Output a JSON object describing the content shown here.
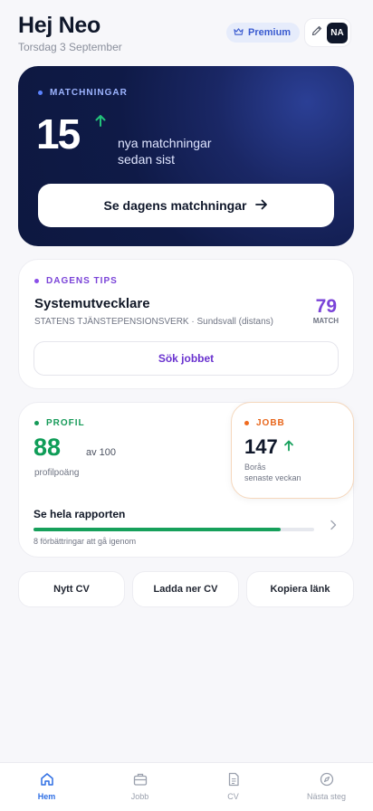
{
  "header": {
    "greeting": "Hej Neo",
    "date": "Torsdag 3 September",
    "premium_label": "Premium",
    "avatar_initials": "NA"
  },
  "hero": {
    "eyebrow": "MATCHNINGAR",
    "count": "15",
    "subtitle": "nya matchningar sedan sist",
    "cta_label": "Se dagens matchningar"
  },
  "tips": {
    "eyebrow": "DAGENS TIPS",
    "job_title": "Systemutvecklare",
    "job_meta": "STATENS TJÄNSTEPENSIONSVERK · Sundsvall (distans)",
    "match_score": "79",
    "match_label": "MATCH",
    "cta_label": "Sök jobbet"
  },
  "profil": {
    "eyebrow": "PROFIL",
    "score": "88",
    "score_suffix": "av 100",
    "score_label": "profilpoäng",
    "report_title": "Se hela rapporten",
    "report_progress": 0.88,
    "report_meta": "8 förbättringar att gå igenom"
  },
  "jobb": {
    "eyebrow": "JOBB",
    "count": "147",
    "location": "Borås",
    "period": "senaste veckan"
  },
  "quick_actions": [
    {
      "label": "Nytt CV"
    },
    {
      "label": "Ladda ner CV"
    },
    {
      "label": "Kopiera länk"
    }
  ],
  "tabs": [
    {
      "label": "Hem",
      "icon": "home-icon",
      "active": true
    },
    {
      "label": "Jobb",
      "icon": "briefcase-icon",
      "active": false
    },
    {
      "label": "CV",
      "icon": "document-icon",
      "active": false
    },
    {
      "label": "Nästa steg",
      "icon": "compass-icon",
      "active": false
    }
  ],
  "colors": {
    "hero_bg": "#0f1a47",
    "accent_blue": "#2f6fe4",
    "accent_purple": "#7a43d8",
    "accent_green": "#0f9d58",
    "accent_orange": "#e8661b"
  }
}
